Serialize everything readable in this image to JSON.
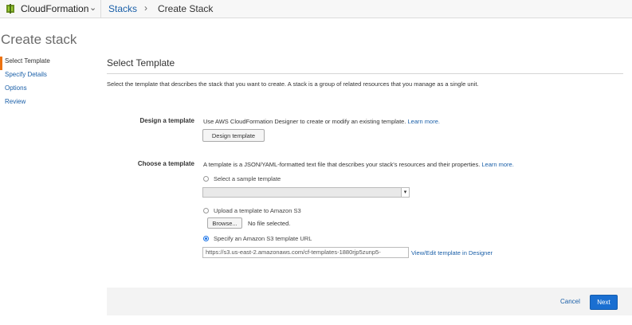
{
  "topbar": {
    "service_name": "CloudFormation",
    "breadcrumb_stacks": "Stacks",
    "breadcrumb_separator": "›",
    "breadcrumb_current": "Create Stack"
  },
  "page": {
    "title": "Create stack"
  },
  "steps": [
    {
      "label": "Select Template",
      "active": true
    },
    {
      "label": "Specify Details",
      "active": false
    },
    {
      "label": "Options",
      "active": false
    },
    {
      "label": "Review",
      "active": false
    }
  ],
  "section": {
    "title": "Select Template",
    "description": "Select the template that describes the stack that you want to create. A stack is a group of related resources that you manage as a single unit."
  },
  "design": {
    "label": "Design a template",
    "help": "Use AWS CloudFormation Designer to create or modify an existing template.",
    "learn_more": "Learn more.",
    "button": "Design template"
  },
  "choose": {
    "label": "Choose a template",
    "help": "A template is a JSON/YAML-formatted text file that describes your stack's resources and their properties.",
    "learn_more": "Learn more.",
    "option_sample": "Select a sample template",
    "sample_select_value": "",
    "option_upload": "Upload a template to Amazon S3",
    "browse_button": "Browse...",
    "no_file": "No file selected.",
    "option_url": "Specify an Amazon S3 template URL",
    "url_value": "https://s3.us-east-2.amazonaws.com/cf-templates-1880rjp5zunp5-",
    "designer_link": "View/Edit template in Designer",
    "selected_option": "url"
  },
  "footer": {
    "cancel": "Cancel",
    "next": "Next"
  },
  "colors": {
    "accent": "#ec7211",
    "link": "#1a5fa8",
    "primary_button": "#1a6fd1"
  }
}
